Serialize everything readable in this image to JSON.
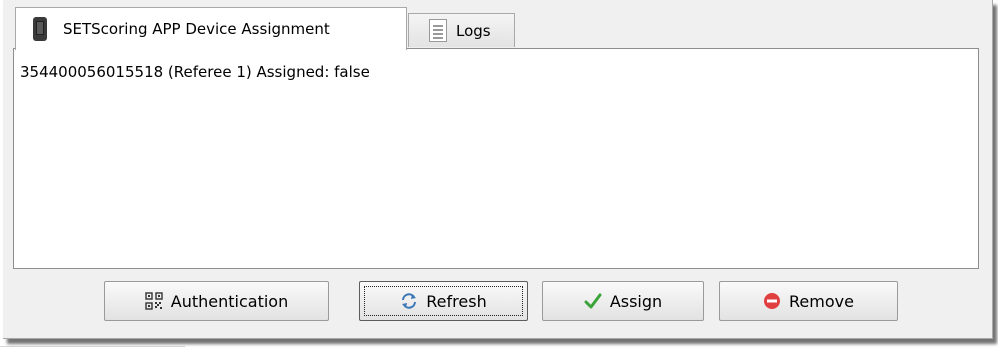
{
  "tabs": [
    {
      "label": "SETScoring APP Device Assignment",
      "icon": "phone-icon",
      "active": true
    },
    {
      "label": "Logs",
      "icon": "document-icon",
      "active": false
    }
  ],
  "list": {
    "items": [
      "354400056015518 (Referee 1) Assigned: false"
    ]
  },
  "buttons": {
    "authentication": {
      "label": "Authentication",
      "icon": "qr-code-icon"
    },
    "refresh": {
      "label": "Refresh",
      "icon": "refresh-icon"
    },
    "assign": {
      "label": "Assign",
      "icon": "checkmark-icon"
    },
    "remove": {
      "label": "Remove",
      "icon": "remove-icon"
    }
  },
  "colors": {
    "assign_icon": "#3aa33a",
    "remove_icon": "#e04040",
    "refresh_icon": "#3b78b8"
  }
}
